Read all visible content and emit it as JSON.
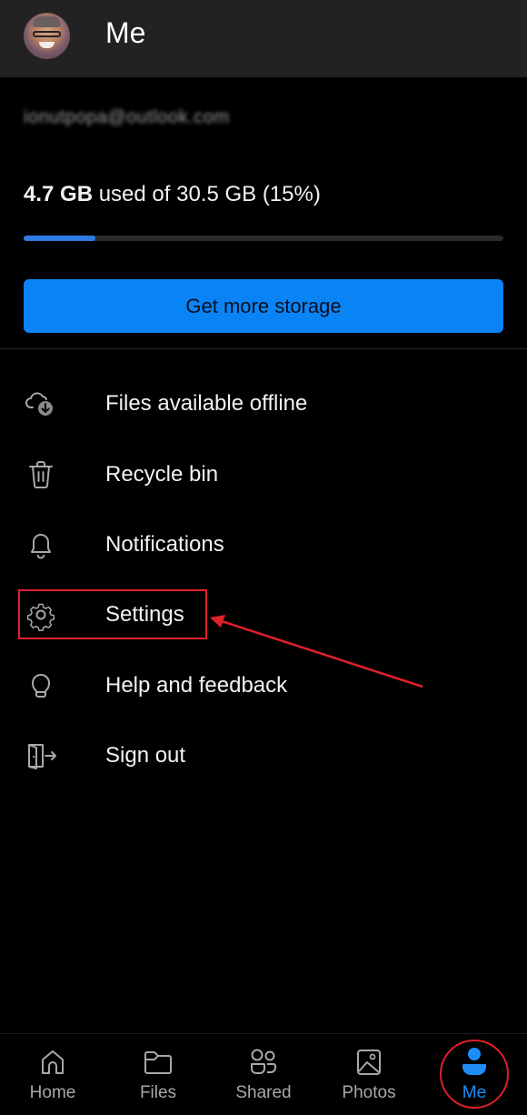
{
  "header": {
    "title": "Me",
    "avatar_alt": "profile-photo"
  },
  "account": {
    "email": "ionutpopa@outlook.com",
    "email_redacted": true
  },
  "storage": {
    "used": "4.7 GB",
    "rest_text": " used of 30.5 GB (15%)",
    "total": "30.5 GB",
    "percent_used": 15,
    "button_label": "Get more storage",
    "accent_color": "#0a84f5",
    "bar_color": "#2e7be6"
  },
  "menu": {
    "items": [
      {
        "label": "Files available offline",
        "icon": "cloud-download-icon"
      },
      {
        "label": "Recycle bin",
        "icon": "trash-icon"
      },
      {
        "label": "Notifications",
        "icon": "bell-icon"
      },
      {
        "label": "Settings",
        "icon": "gear-icon",
        "highlighted": true
      },
      {
        "label": "Help and feedback",
        "icon": "lightbulb-icon"
      },
      {
        "label": "Sign out",
        "icon": "sign-out-icon"
      }
    ]
  },
  "annotation": {
    "color": "#e0202a",
    "highlight_target": "Settings",
    "highlight_nav": "Me"
  },
  "bottom_nav": {
    "items": [
      {
        "label": "Home",
        "icon": "home-icon"
      },
      {
        "label": "Files",
        "icon": "folder-icon"
      },
      {
        "label": "Shared",
        "icon": "shared-people-icon"
      },
      {
        "label": "Photos",
        "icon": "photo-icon"
      },
      {
        "label": "Me",
        "icon": "person-icon",
        "active": true
      }
    ],
    "active_color": "#1e8cf5"
  }
}
